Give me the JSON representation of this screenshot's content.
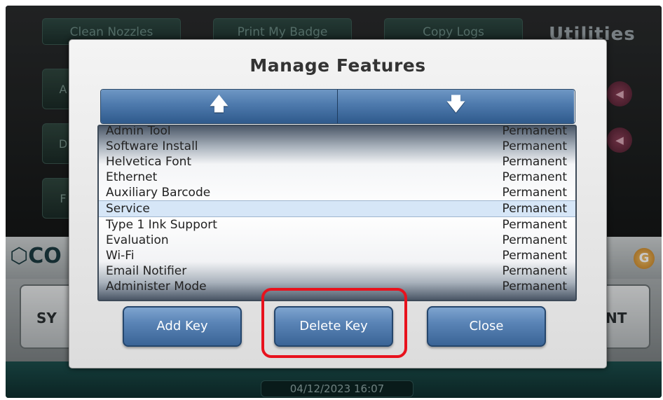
{
  "background": {
    "title": "Utilities",
    "top_buttons": [
      "Clean Nozzles",
      "Print My Badge",
      "Copy Logs"
    ],
    "side_buttons": [
      "A",
      "D",
      "F"
    ],
    "logo_text": "CO",
    "bottom_buttons": [
      "SY",
      "NT"
    ],
    "timestamp": "04/12/2023 16:07"
  },
  "modal": {
    "title": "Manage Features",
    "scroll_up_icon": "arrow-up-icon",
    "scroll_down_icon": "arrow-down-icon",
    "features": [
      {
        "name": "Admin Tool",
        "status": "Permanent"
      },
      {
        "name": "Software Install",
        "status": "Permanent"
      },
      {
        "name": "Helvetica Font",
        "status": "Permanent"
      },
      {
        "name": "Ethernet",
        "status": "Permanent"
      },
      {
        "name": "Auxiliary Barcode",
        "status": "Permanent"
      },
      {
        "name": "Service",
        "status": "Permanent",
        "selected": true
      },
      {
        "name": "Type 1 Ink Support",
        "status": "Permanent"
      },
      {
        "name": "Evaluation",
        "status": "Permanent"
      },
      {
        "name": "Wi-Fi",
        "status": "Permanent"
      },
      {
        "name": "Email Notifier",
        "status": "Permanent"
      },
      {
        "name": "Administer Mode",
        "status": "Permanent"
      }
    ],
    "buttons": {
      "add_key": "Add Key",
      "delete_key": "Delete Key",
      "close": "Close"
    }
  },
  "colors": {
    "accent_highlight": "#e8121d",
    "button_blue": "#4d79ac",
    "selected_row": "#d6e6f7"
  }
}
